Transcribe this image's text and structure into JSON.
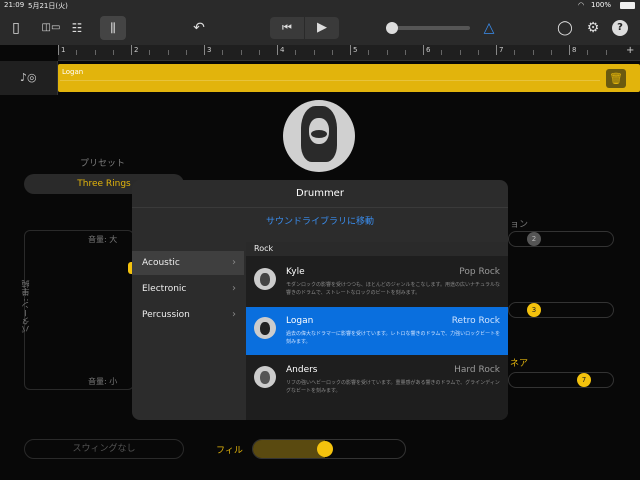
{
  "status": {
    "time": "21:09",
    "date": "5月21日(火)",
    "battery": "100%"
  },
  "ruler": {
    "marks": [
      "1",
      "2",
      "3",
      "4",
      "5",
      "6",
      "7",
      "8"
    ]
  },
  "track": {
    "region_label": "Logan"
  },
  "main": {
    "preset_label": "プリセット",
    "preset_value": "Three Rings",
    "volume_high": "音量: 大",
    "volume_low": "音量: 小",
    "pattern_label": "パターン: 単純",
    "swing_label": "スウィングなし",
    "fill_label": "フィル",
    "right_label_1": "ョン",
    "right_label_2": "ネア",
    "knob_values": [
      "2",
      "3",
      "7"
    ]
  },
  "popup": {
    "title": "Drummer",
    "link": "サウンドライブラリに移動",
    "categories": [
      {
        "label": "Acoustic"
      },
      {
        "label": "Electronic"
      },
      {
        "label": "Percussion"
      }
    ],
    "section": "Rock",
    "drummers": [
      {
        "name": "Kyle",
        "style": "Pop Rock",
        "desc": "モダンロックの影響を受けつつも、ほとんどのジャンルをこなします。用途の広いナチュラルな響きのドラムで、ストレートなロックのビートを刻みます。"
      },
      {
        "name": "Logan",
        "style": "Retro Rock",
        "desc": "過去の偉大なドラマーに影響を受けています。レトロな響きのドラムで、力強いロックビートを刻みます。"
      },
      {
        "name": "Anders",
        "style": "Hard Rock",
        "desc": "リフの強いヘビーロックの影響を受けています。重量感がある響きのドラムで、グラインディングなビートを刻みます。"
      }
    ]
  },
  "colors": {
    "accent": "#e2b40c",
    "selection": "#0a6fde",
    "link": "#3a8ef0"
  }
}
